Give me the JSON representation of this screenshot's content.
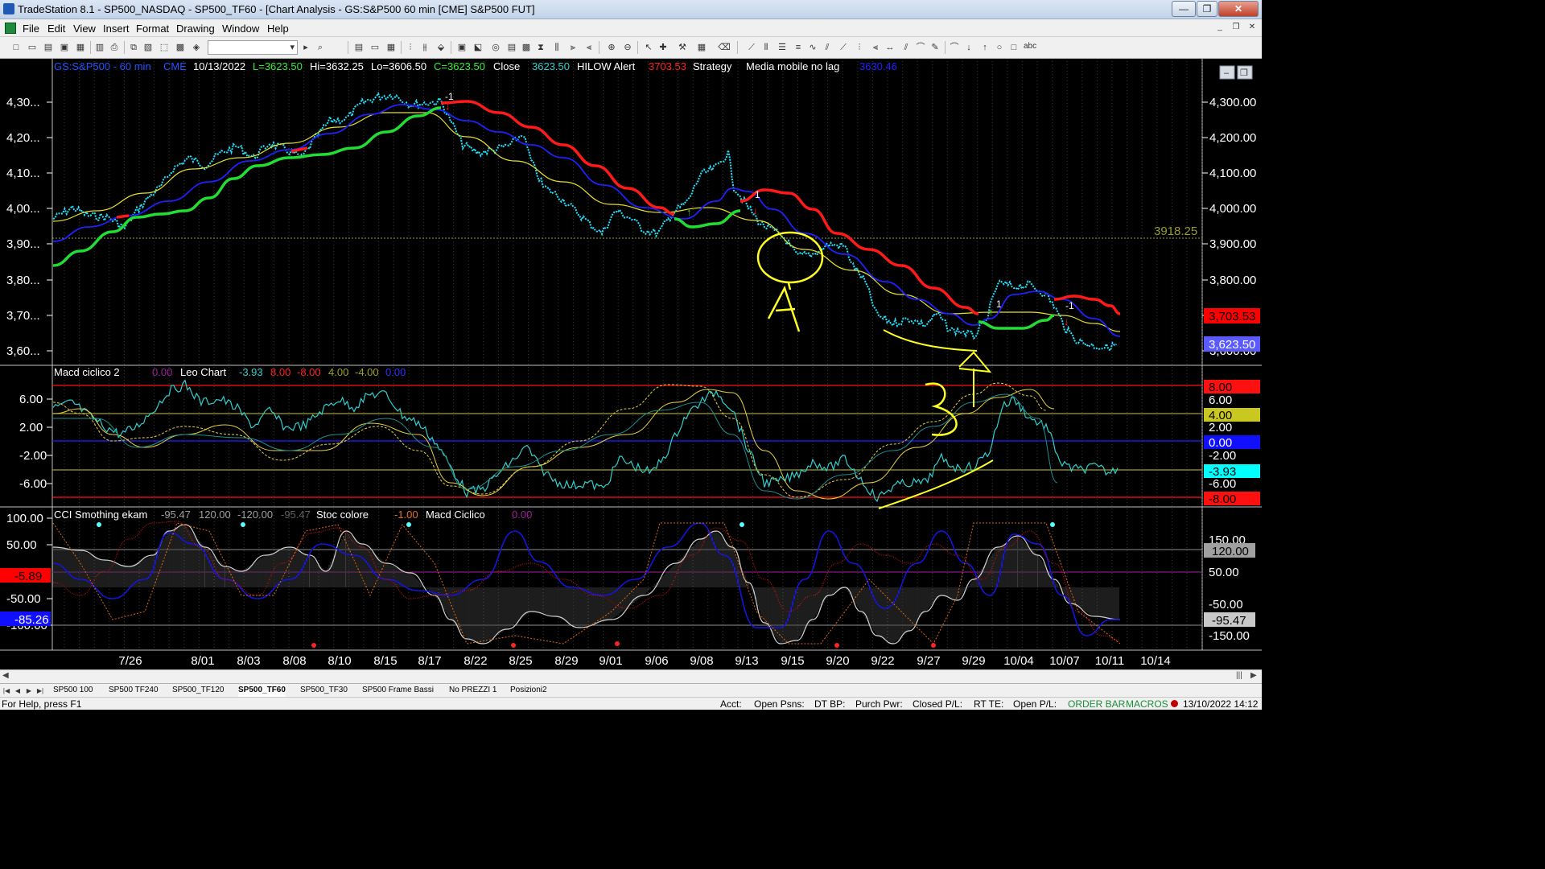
{
  "window": {
    "title": "TradeStation 8.1 - SP500_NASDAQ - SP500_TF60 - [Chart Analysis - GS:S&P500  60 min  [CME] S&P500 FUT]",
    "controls": [
      "—",
      "❐",
      "✕"
    ]
  },
  "menu": [
    "File",
    "Edit",
    "View",
    "Insert",
    "Format",
    "Drawing",
    "Window",
    "Help"
  ],
  "mdi_controls": [
    "_",
    "❐",
    "✕"
  ],
  "toolbar_text": "abc",
  "chart": {
    "symbol": "GS:S&P500 - 60 min",
    "exchange": "CME",
    "date": "10/13/2022",
    "last": "L=3623.50",
    "high": "Hi=3632.25",
    "low": "Lo=3606.50",
    "close": "C=3623.50",
    "close_label": "Close",
    "close_value": "3623.50",
    "hilow_label": "HILOW Alert",
    "hilow_value": "3703.53",
    "strategy_label": "Strategy",
    "media_label": "Media mobile no lag",
    "media_value": "3630.46",
    "mini_controls": [
      "–",
      "❐"
    ]
  },
  "price_pane": {
    "left_ticks": [
      "4,30...",
      "4,20...",
      "4,10...",
      "4,00...",
      "3,90...",
      "3,80...",
      "3,70...",
      "3,60..."
    ],
    "right_ticks": [
      "4,300.00",
      "4,200.00",
      "4,100.00",
      "4,000.00",
      "3,900.00",
      "3,800.00",
      "3,700.00",
      "3,600.00"
    ],
    "level_label": "3918.25",
    "badges": [
      {
        "text": "3,703.53",
        "bg": "#ff0000",
        "fg": "#000000"
      },
      {
        "text": "3,623.50",
        "bg": "#5a5aff",
        "fg": "#ffffff"
      }
    ],
    "signal_labels": [
      "-1",
      "1",
      "1",
      "-1"
    ],
    "annotations": [
      "A",
      "B"
    ]
  },
  "macd_pane": {
    "header": [
      {
        "text": "Macd ciclico 2",
        "color": "#ffffff"
      },
      {
        "text": "0.00",
        "color": "#a020a0"
      },
      {
        "text": "Leo Chart",
        "color": "#ffffff"
      },
      {
        "text": "-3.93",
        "color": "#2fd0d0"
      },
      {
        "text": "8.00",
        "color": "#ff2020"
      },
      {
        "text": "-8.00",
        "color": "#ff2020"
      },
      {
        "text": "4.00",
        "color": "#a0a020"
      },
      {
        "text": "-4.00",
        "color": "#a0a020"
      },
      {
        "text": "0.00",
        "color": "#3030ff"
      }
    ],
    "left_ticks": [
      "6.00",
      "2.00",
      "-2.00",
      "-6.00"
    ],
    "right_ticks": [
      "6.00",
      "2.00",
      "-2.00",
      "-6.00"
    ],
    "badges": [
      {
        "text": "8.00",
        "bg": "#ff1010",
        "fg": "#000000"
      },
      {
        "text": "4.00",
        "bg": "#c8c820",
        "fg": "#000000"
      },
      {
        "text": "0.00",
        "bg": "#1010ff",
        "fg": "#ffffff"
      },
      {
        "text": "-3.93",
        "bg": "#00ffff",
        "fg": "#000000"
      },
      {
        "text": "-8.00",
        "bg": "#ff1010",
        "fg": "#000000"
      }
    ]
  },
  "cci_pane": {
    "header": [
      {
        "text": "CCI Smothing ekam",
        "color": "#ffffff"
      },
      {
        "text": "-95.47",
        "color": "#a0a0a0"
      },
      {
        "text": "120.00",
        "color": "#a0a0a0"
      },
      {
        "text": "-120.00",
        "color": "#a0a0a0"
      },
      {
        "text": "-95.47",
        "color": "#606060"
      },
      {
        "text": "Stoc colore",
        "color": "#ffffff"
      },
      {
        "text": "-1.00",
        "color": "#e07020"
      },
      {
        "text": "Macd Ciclico",
        "color": "#ffffff"
      },
      {
        "text": "0.00",
        "color": "#a020a0"
      }
    ],
    "left_ticks": [
      "100.00",
      "50.00",
      "-50.00",
      "-100.00"
    ],
    "right_ticks": [
      "150.00",
      "50.00",
      "-50.00",
      "-150.00"
    ],
    "left_badges": [
      {
        "text": "-5.89",
        "bg": "#ff0000",
        "fg": "#000000"
      },
      {
        "text": "-85.26",
        "bg": "#1010ff",
        "fg": "#ffffff"
      }
    ],
    "right_badges": [
      {
        "text": "120.00",
        "bg": "#a0a0a0",
        "fg": "#000000"
      },
      {
        "text": "-95.47",
        "bg": "#c8c8c8",
        "fg": "#000000"
      }
    ]
  },
  "x_axis": [
    "7/26",
    "8/01",
    "8/03",
    "8/08",
    "8/10",
    "8/15",
    "8/17",
    "8/22",
    "8/25",
    "8/29",
    "9/01",
    "9/06",
    "9/08",
    "9/13",
    "9/15",
    "9/20",
    "9/22",
    "9/27",
    "9/29",
    "10/04",
    "10/07",
    "10/11",
    "10/14"
  ],
  "tabs": [
    "SP500 100",
    "SP500 TF240",
    "SP500_TF120",
    "SP500_TF60",
    "SP500_TF30",
    "SP500 Frame Bassi",
    "No PREZZI 1",
    "Posizioni2"
  ],
  "active_tab": "SP500_TF60",
  "status": {
    "help": "For Help, press F1",
    "fields": [
      "Acct:",
      "Open Psns:",
      "DT BP:",
      "Purch Pwr:",
      "Closed P/L:",
      "RT TE:",
      "Open P/L:"
    ],
    "order_bar": "ORDER BAR",
    "macros": "MACROS",
    "datetime": "13/10/2022 14:12"
  },
  "colors": {
    "price_dots": "#1fe3ff",
    "ma_red": "#ff1a1a",
    "ma_green": "#22dd33",
    "ma_blue": "#2020ff",
    "ma_yellow": "#e6e02a",
    "annotation": "#ffff20"
  }
}
